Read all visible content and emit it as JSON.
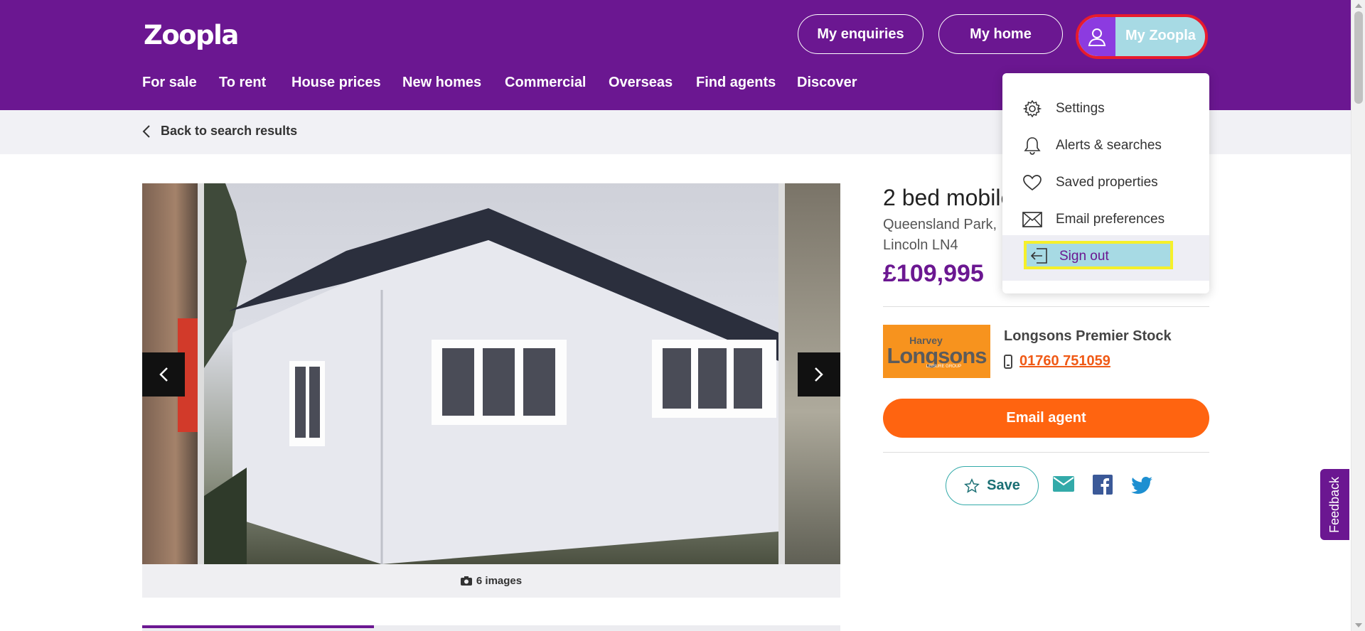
{
  "header": {
    "logo": "Zoopla",
    "my_enquiries": "My enquiries",
    "my_home": "My home",
    "my_zoopla": "My Zoopla",
    "nav": [
      "For sale",
      "To rent",
      "House prices",
      "New homes",
      "Commercial",
      "Overseas",
      "Find agents",
      "Discover"
    ]
  },
  "subbar": {
    "back": "Back to search results"
  },
  "gallery": {
    "count": "6 images"
  },
  "listing": {
    "title": "2 bed mobile",
    "address_line1": "Queensland Park,",
    "address_line2": "Lincoln LN4",
    "price": "£109,995"
  },
  "agent": {
    "logo_top": "Harvey",
    "logo_main": "Longsons",
    "logo_sub": "LEISURE GROUP",
    "name": "Longsons Premier Stock",
    "phone": "01760 751059"
  },
  "actions": {
    "email_agent": "Email agent",
    "save": "Save"
  },
  "feedback": "Feedback",
  "menu": {
    "items": [
      {
        "label": "Settings",
        "icon": "gear-icon"
      },
      {
        "label": "Alerts & searches",
        "icon": "bell-icon"
      },
      {
        "label": "Saved properties",
        "icon": "heart-icon"
      },
      {
        "label": "Email preferences",
        "icon": "envelope-icon"
      },
      {
        "label": "Sign out",
        "icon": "sign-out-icon"
      }
    ]
  },
  "colors": {
    "brand_purple": "#6b1791",
    "accent_orange": "#ff6410",
    "teal": "#33aaa9",
    "highlight_yellow": "#f5f02a",
    "highlight_red": "#e81b2d"
  }
}
